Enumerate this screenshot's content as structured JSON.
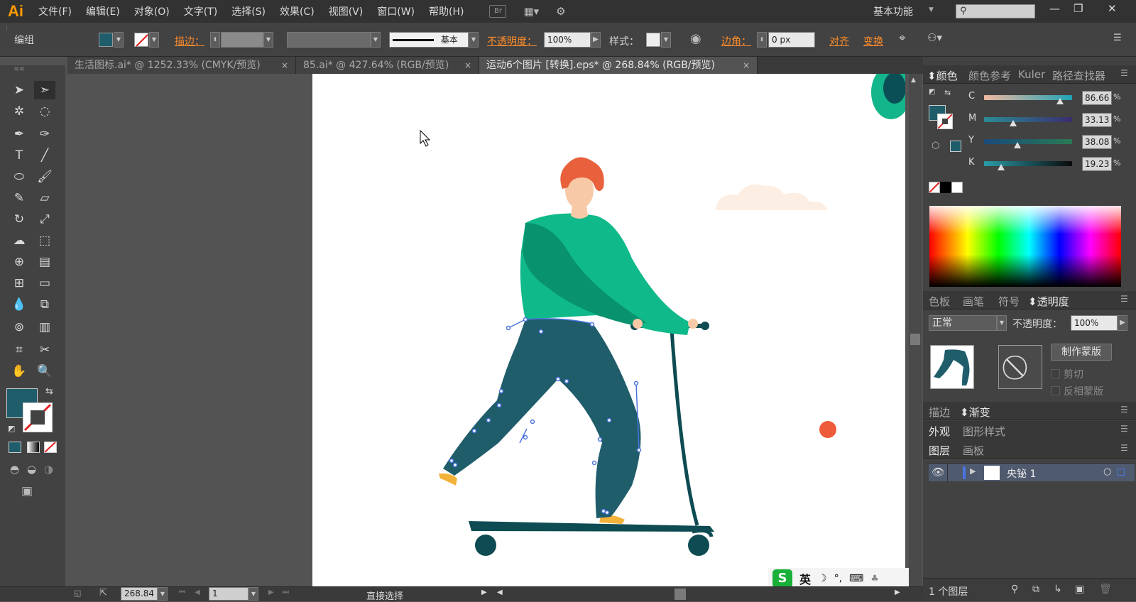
{
  "app": {
    "logo": "Ai"
  },
  "menu": [
    "文件(F)",
    "编辑(E)",
    "对象(O)",
    "文字(T)",
    "选择(S)",
    "效果(C)",
    "视图(V)",
    "窗口(W)",
    "帮助(H)"
  ],
  "bridge_label": "Br",
  "workspace_label": "基本功能",
  "search_placeholder": "",
  "window_buttons": {
    "minimize": "—",
    "restore": "❐",
    "close": "✕"
  },
  "control": {
    "selection_label": "编组",
    "stroke_label": "描边：",
    "stroke_style_label": "基本",
    "opacity_label": "不透明度：",
    "opacity_value": "100%",
    "style_label": "样式：",
    "corner_label": "边角：",
    "corner_value": "0 px",
    "align_label": "对齐",
    "transform_label": "变换",
    "fill_color": "#1f5d6b"
  },
  "tabs": [
    {
      "label": "生活图标.ai* @ 1252.33% (CMYK/预览)",
      "active": false
    },
    {
      "label": "85.ai* @ 427.64% (RGB/预览)",
      "active": false
    },
    {
      "label": "运动6个图片  [转换].eps* @ 268.84% (RGB/预览)",
      "active": true
    }
  ],
  "tab_close": "×",
  "tools_fill_color": "#1f5d6b",
  "status": {
    "zoom": "268.84",
    "page": "1",
    "tool_name": "直接选择"
  },
  "ime": {
    "lang": "英",
    "icon": "sogou-icon"
  },
  "color_panel": {
    "tabs": [
      "颜色",
      "颜色参考",
      "Kuler",
      "路径查找器"
    ],
    "sliders": [
      {
        "label": "C",
        "value": "86.66",
        "pct": "%",
        "fraction": 0.8666,
        "from": "#f0b8a0",
        "to": "#1fa3b4"
      },
      {
        "label": "M",
        "value": "33.13",
        "pct": "%",
        "fraction": 0.3313,
        "from": "#2a8c95",
        "to": "#3b2d6e"
      },
      {
        "label": "Y",
        "value": "38.08",
        "pct": "%",
        "fraction": 0.3808,
        "from": "#1a4a7a",
        "to": "#2a7a55"
      },
      {
        "label": "K",
        "value": "19.23",
        "pct": "%",
        "fraction": 0.1923,
        "from": "#2a9caa",
        "to": "#0a0a0a"
      }
    ]
  },
  "swatch_panel": {
    "tabs": [
      "色板",
      "画笔",
      "符号",
      "透明度"
    ]
  },
  "transparency": {
    "blend_mode": "正常",
    "opacity_label": "不透明度：",
    "opacity_value": "100%",
    "make_mask": "制作蒙版",
    "clip": "剪切",
    "invert": "反相蒙版"
  },
  "stroke_panel": {
    "tabs": [
      "描边",
      "渐变"
    ]
  },
  "appearance_panel": {
    "tabs": [
      "外观",
      "图形样式"
    ]
  },
  "layers_panel": {
    "tabs": [
      "图层",
      "画板"
    ],
    "layer_name": "央铋 1",
    "footer": "1 个图层"
  },
  "art_colors": {
    "hair": "#e8603c",
    "skin": "#f8c9a6",
    "shirt": "#10b98a",
    "shirt_shade": "#08926d",
    "pants": "#1f5d6b",
    "scooter": "#0e4b52",
    "shoe": "#f3b23a",
    "cloud": "#fdeee3",
    "dot": "#ee5b3a",
    "corner": "#0b4f56",
    "corner_ring": "#13b68a",
    "path_handle": "#4a74e0"
  }
}
